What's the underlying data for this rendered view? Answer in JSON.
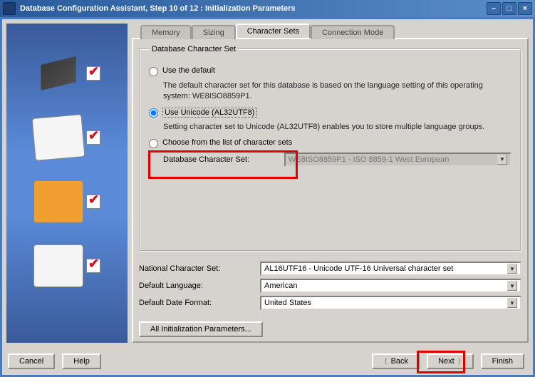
{
  "window": {
    "title": "Database Configuration Assistant, Step 10 of 12 : Initialization Parameters"
  },
  "tabs": {
    "memory": "Memory",
    "sizing": "Sizing",
    "charsets": "Character Sets",
    "connmode": "Connection Mode"
  },
  "group": {
    "legend": "Database Character Set",
    "opt_default_label": "Use the default",
    "opt_default_desc": "The default character set for this database is based on the language setting of this operating system: WE8ISO8859P1.",
    "opt_unicode_label": "Use Unicode (AL32UTF8)",
    "opt_unicode_desc": "Setting character set to Unicode (AL32UTF8) enables you to store multiple language groups.",
    "opt_choose_label": "Choose from the list of character sets",
    "dbcharset_label": "Database Character Set:",
    "dbcharset_value": "WE8ISO8859P1 - ISO 8859-1 West European"
  },
  "fields": {
    "national_label": "National Character Set:",
    "national_value": "AL16UTF16 - Unicode UTF-16 Universal character set",
    "defaultlang_label": "Default Language:",
    "defaultlang_value": "American",
    "defaultdate_label": "Default Date Format:",
    "defaultdate_value": "United States"
  },
  "buttons": {
    "all_init": "All Initialization Parameters...",
    "cancel": "Cancel",
    "help": "Help",
    "back": "Back",
    "next": "Next",
    "finish": "Finish"
  }
}
